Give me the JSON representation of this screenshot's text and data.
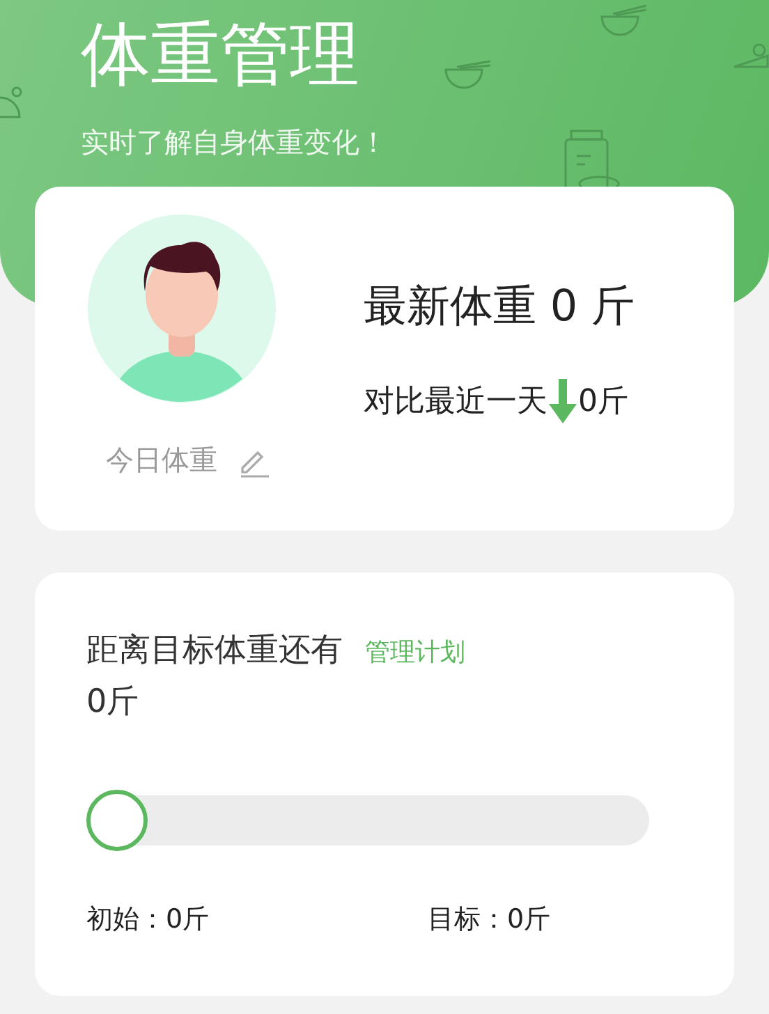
{
  "header": {
    "title": "体重管理",
    "subtitle": "实时了解自身体重变化！"
  },
  "summary": {
    "today_label": "今日体重",
    "latest": "最新体重 0 斤",
    "compare_label": "对比最近一天",
    "decreased": true,
    "compare_value": "0斤"
  },
  "goal": {
    "title": "距离目标体重还有",
    "link": "管理计划",
    "remaining": "0斤",
    "progress": {
      "level": 0
    },
    "start": "初始：0斤",
    "target": "目标：0斤"
  }
}
